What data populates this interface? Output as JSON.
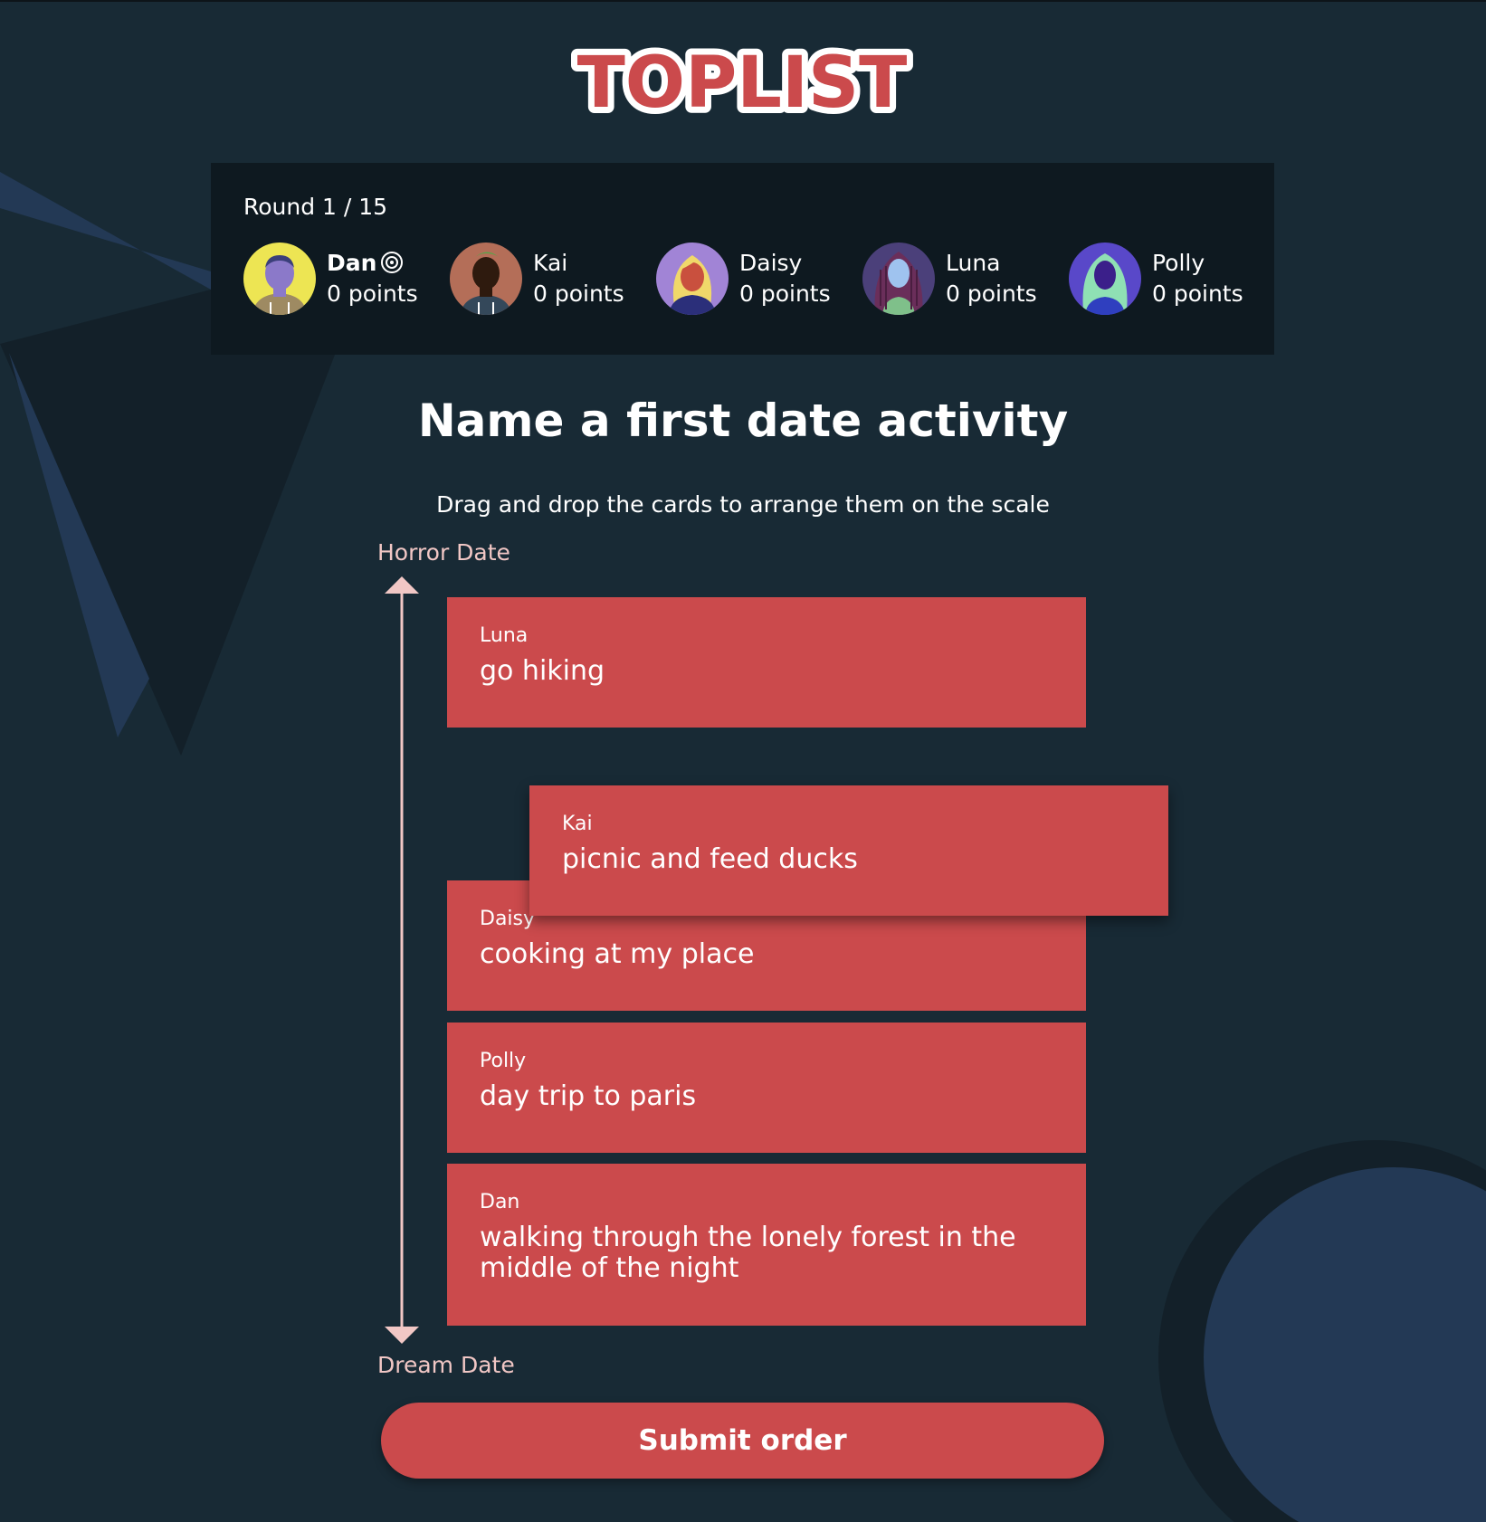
{
  "app": {
    "logo_text": "TOPLIST"
  },
  "round": {
    "label": "Round 1 / 15"
  },
  "players": [
    {
      "name": "Dan",
      "points": "0 points",
      "is_host": true,
      "badge_icon": "host-badge-icon",
      "avatar_bg": "#ede553"
    },
    {
      "name": "Kai",
      "points": "0 points",
      "is_host": false,
      "avatar_bg": "#b46e58"
    },
    {
      "name": "Daisy",
      "points": "0 points",
      "is_host": false,
      "avatar_bg": "#a184d6"
    },
    {
      "name": "Luna",
      "points": "0 points",
      "is_host": false,
      "avatar_bg": "#4b407a"
    },
    {
      "name": "Polly",
      "points": "0 points",
      "is_host": false,
      "avatar_bg": "#5948c9"
    }
  ],
  "question": {
    "title": "Name a first date activity",
    "instruction": "Drag and drop the cards to arrange them on the scale"
  },
  "scale": {
    "top_label": "Horror Date",
    "bottom_label": "Dream Date"
  },
  "cards": [
    {
      "author": "Luna",
      "text": "go hiking"
    },
    {
      "author": "Kai",
      "text": "picnic and feed ducks",
      "state": "dragging"
    },
    {
      "author": "Daisy",
      "text": "cooking at my place"
    },
    {
      "author": "Polly",
      "text": "day trip to paris"
    },
    {
      "author": "Dan",
      "text": "walking through the lonely forest in the middle of the night"
    }
  ],
  "actions": {
    "submit_label": "Submit order"
  },
  "colors": {
    "background": "#182a35",
    "panel": "#0e1920",
    "accent": "#cb4a4c",
    "scale": "#f1c7c5",
    "decor": "#233955"
  }
}
